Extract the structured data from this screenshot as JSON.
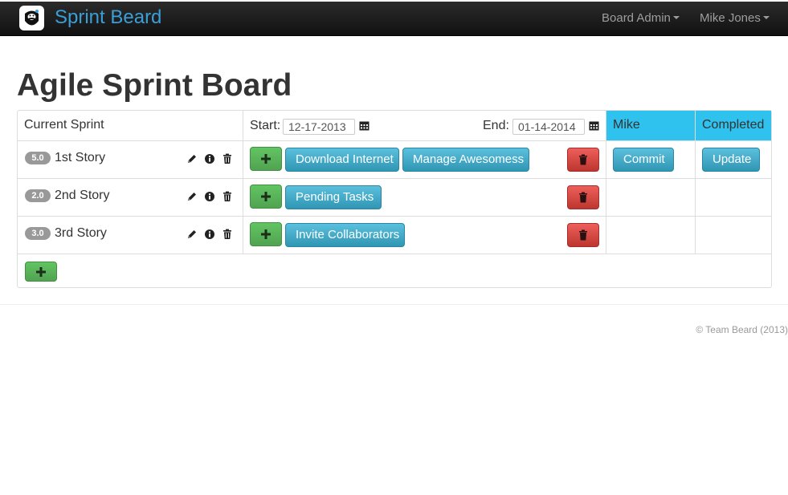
{
  "nav": {
    "brand": "Sprint Beard",
    "menus": [
      "Board Admin",
      "Mike Jones"
    ]
  },
  "page": {
    "title": "Agile Sprint Board"
  },
  "board": {
    "header": {
      "sprint_label": "Current Sprint",
      "start_label": "Start:",
      "start_value": "12-17-2013",
      "end_label": "End:",
      "end_value": "01-14-2014",
      "columns": [
        "Mike",
        "Completed"
      ]
    },
    "stories": [
      {
        "points": "5.0",
        "name": "1st Story",
        "tasks": [
          "Download Internet",
          "Manage Awesomess"
        ],
        "mike": "Commit",
        "completed": "Update"
      },
      {
        "points": "2.0",
        "name": "2nd Story",
        "tasks": [
          "Pending Tasks"
        ],
        "mike": "",
        "completed": ""
      },
      {
        "points": "3.0",
        "name": "3rd Story",
        "tasks": [
          "Invite Collaborators"
        ],
        "mike": "",
        "completed": ""
      }
    ]
  },
  "footer": {
    "text": "© Team Beard (2013)"
  },
  "colors": {
    "accent": "#3a9fd8",
    "header_highlight": "#2fc2ee",
    "success": "#5bb75b",
    "info": "#49afcd",
    "danger": "#da4f49"
  },
  "icons": [
    "beard-logo-icon",
    "pencil-icon",
    "info-icon",
    "trash-icon",
    "plus-icon",
    "calendar-icon",
    "caret-down-icon"
  ]
}
